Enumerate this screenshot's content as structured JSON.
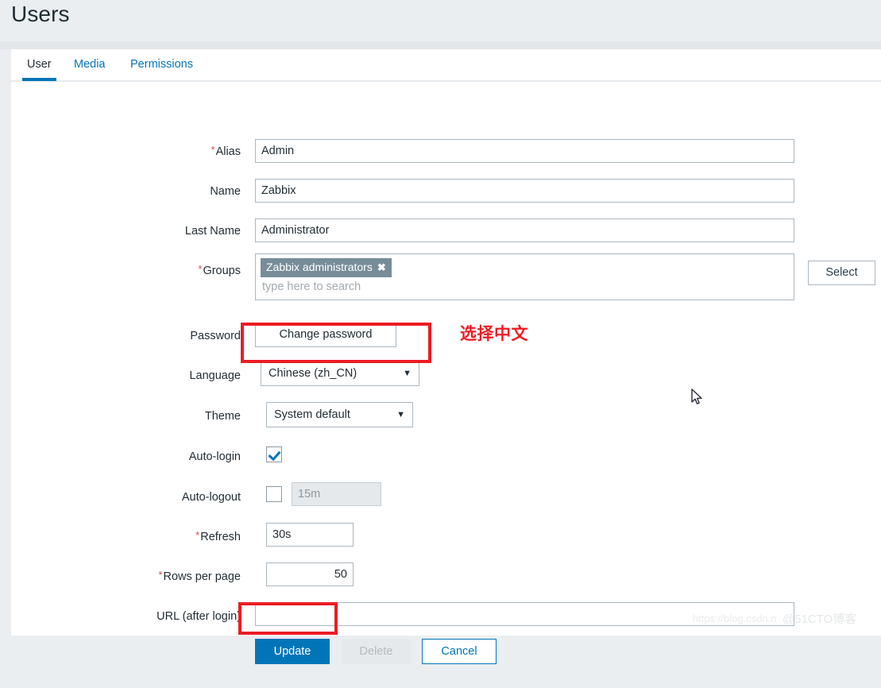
{
  "page": {
    "title": "Users"
  },
  "tabs": [
    {
      "label": "User",
      "active": true
    },
    {
      "label": "Media",
      "active": false
    },
    {
      "label": "Permissions",
      "active": false
    }
  ],
  "form": {
    "alias": {
      "label": "Alias",
      "required": true,
      "value": "Admin"
    },
    "name": {
      "label": "Name",
      "required": false,
      "value": "Zabbix"
    },
    "last_name": {
      "label": "Last Name",
      "required": false,
      "value": "Administrator"
    },
    "groups": {
      "label": "Groups",
      "required": true,
      "chips": [
        "Zabbix administrators"
      ],
      "chip_remove_icon": "close-icon",
      "placeholder": "type here to search",
      "select_button": "Select"
    },
    "password": {
      "label": "Password",
      "button": "Change password"
    },
    "language": {
      "label": "Language",
      "value": "Chinese (zh_CN)",
      "caret_icon": "chevron-down-icon"
    },
    "theme": {
      "label": "Theme",
      "value": "System default",
      "caret_icon": "chevron-down-icon"
    },
    "auto_login": {
      "label": "Auto-login",
      "checked": true
    },
    "auto_logout": {
      "label": "Auto-logout",
      "checked": false,
      "value": "15m",
      "disabled": true
    },
    "refresh": {
      "label": "Refresh",
      "required": true,
      "value": "30s"
    },
    "rows_per_page": {
      "label": "Rows per page",
      "required": true,
      "value": "50"
    },
    "url_after_login": {
      "label": "URL (after login)",
      "required": false,
      "value": ""
    }
  },
  "footer_buttons": {
    "update": "Update",
    "delete": "Delete",
    "cancel": "Cancel"
  },
  "annotations": {
    "language_note": "选择中文"
  },
  "watermark": {
    "url": "https://blog.csdn.n",
    "tag": "@51CTO博客"
  },
  "colors": {
    "accent_blue": "#0275b8",
    "annotation_red": "#ec1c24",
    "required_red": "#d64e4e",
    "chip_gray": "#768d99",
    "page_bg": "#ebeef0"
  }
}
